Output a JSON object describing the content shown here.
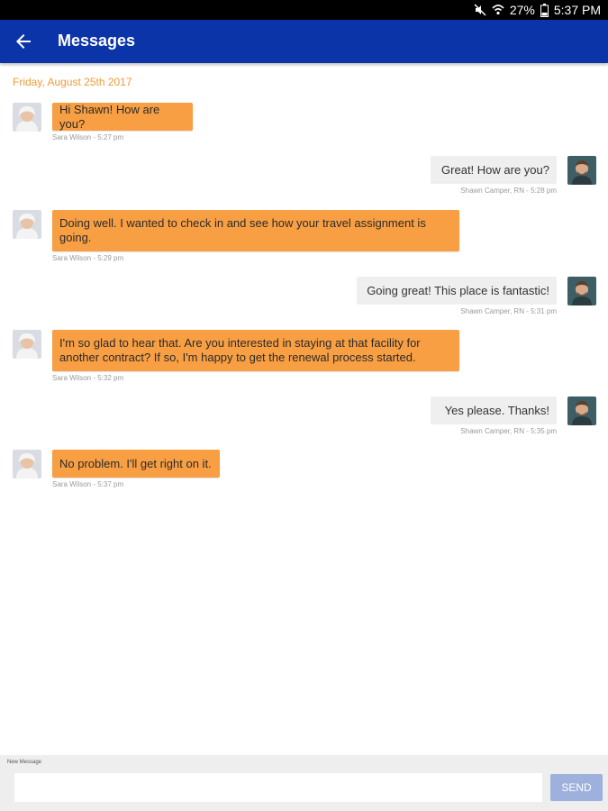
{
  "status_bar": {
    "battery": "27%",
    "time": "5:37 PM",
    "icons": [
      "mute-icon",
      "wifi-icon",
      "battery-icon"
    ]
  },
  "header": {
    "title": "Messages",
    "back_icon": "arrow-left-icon",
    "color": "#0a34a8"
  },
  "date_label": "Friday, August 25th 2017",
  "colors": {
    "incoming_bubble": "#f89f43",
    "outgoing_bubble": "#efefef",
    "date_label": "#f29a35",
    "send_button": "#9eb0dc"
  },
  "messages": [
    {
      "direction": "incoming",
      "text": "Hi Shawn! How are you?",
      "meta": "Sara Wilson - 5:27 pm"
    },
    {
      "direction": "outgoing",
      "text": "Great! How are you?",
      "meta": "Shawn Camper, RN - 5:28 pm"
    },
    {
      "direction": "incoming",
      "text": "Doing well. I wanted to check in and see how your travel assignment is going.",
      "meta": "Sara Wilson - 5:29 pm"
    },
    {
      "direction": "outgoing",
      "text": "Going great! This place is fantastic!",
      "meta": "Shawn Camper, RN - 5:31 pm"
    },
    {
      "direction": "incoming",
      "text": "I'm so glad to hear that. Are you interested in staying at that facility for another contract? If so, I'm happy to get the renewal process started.",
      "meta": "Sara Wilson - 5:32 pm"
    },
    {
      "direction": "outgoing",
      "text": "Yes please. Thanks!",
      "meta": "Shawn Camper, RN - 5:35 pm"
    },
    {
      "direction": "incoming",
      "text": "No problem. I'll get right on it.",
      "meta": "Sara Wilson - 5:37 pm"
    }
  ],
  "composer": {
    "label": "New Message",
    "value": "",
    "send_label": "SEND"
  }
}
